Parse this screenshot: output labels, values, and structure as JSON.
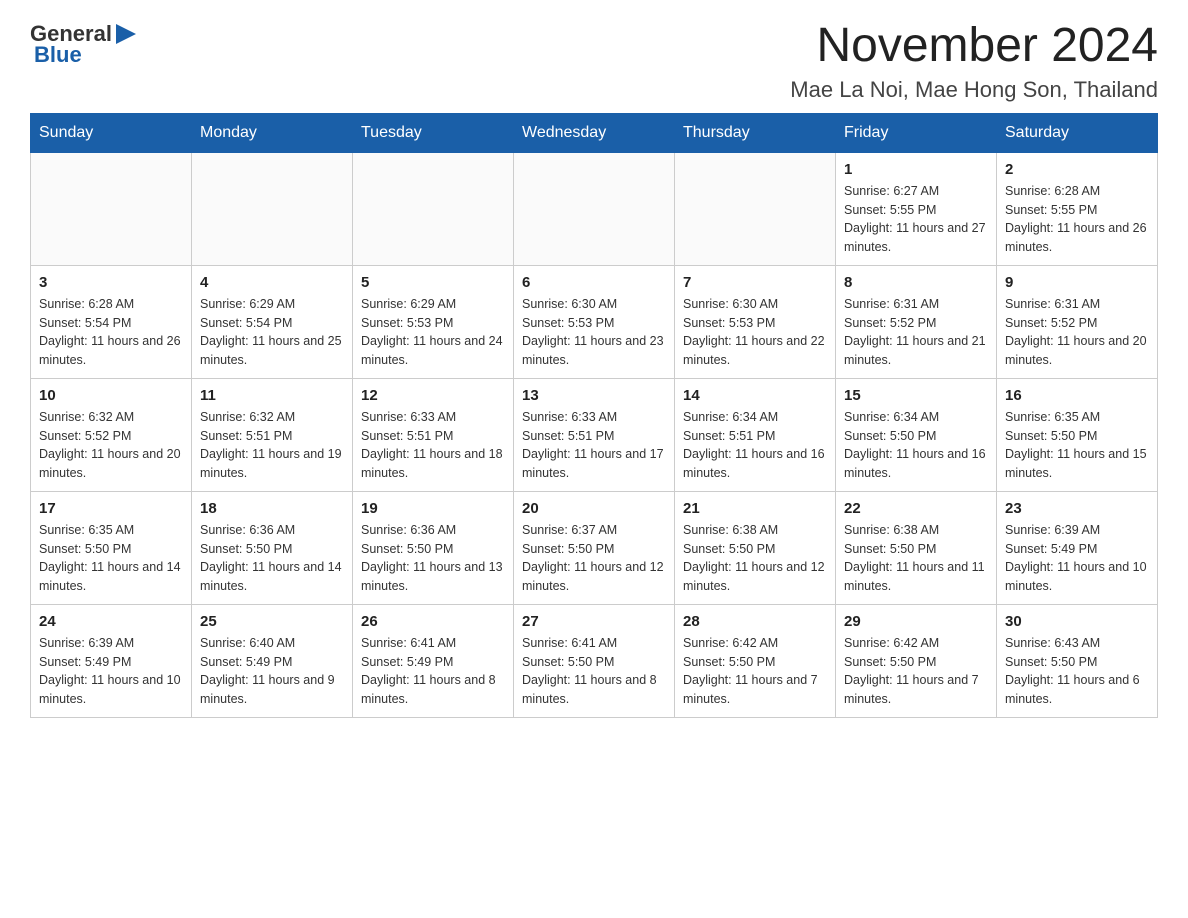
{
  "header": {
    "logo": {
      "general": "General",
      "arrow_icon": "▶",
      "blue": "Blue"
    },
    "title": "November 2024",
    "location": "Mae La Noi, Mae Hong Son, Thailand"
  },
  "weekdays": [
    "Sunday",
    "Monday",
    "Tuesday",
    "Wednesday",
    "Thursday",
    "Friday",
    "Saturday"
  ],
  "weeks": [
    [
      {
        "day": "",
        "sunrise": "",
        "sunset": "",
        "daylight": ""
      },
      {
        "day": "",
        "sunrise": "",
        "sunset": "",
        "daylight": ""
      },
      {
        "day": "",
        "sunrise": "",
        "sunset": "",
        "daylight": ""
      },
      {
        "day": "",
        "sunrise": "",
        "sunset": "",
        "daylight": ""
      },
      {
        "day": "",
        "sunrise": "",
        "sunset": "",
        "daylight": ""
      },
      {
        "day": "1",
        "sunrise": "Sunrise: 6:27 AM",
        "sunset": "Sunset: 5:55 PM",
        "daylight": "Daylight: 11 hours and 27 minutes."
      },
      {
        "day": "2",
        "sunrise": "Sunrise: 6:28 AM",
        "sunset": "Sunset: 5:55 PM",
        "daylight": "Daylight: 11 hours and 26 minutes."
      }
    ],
    [
      {
        "day": "3",
        "sunrise": "Sunrise: 6:28 AM",
        "sunset": "Sunset: 5:54 PM",
        "daylight": "Daylight: 11 hours and 26 minutes."
      },
      {
        "day": "4",
        "sunrise": "Sunrise: 6:29 AM",
        "sunset": "Sunset: 5:54 PM",
        "daylight": "Daylight: 11 hours and 25 minutes."
      },
      {
        "day": "5",
        "sunrise": "Sunrise: 6:29 AM",
        "sunset": "Sunset: 5:53 PM",
        "daylight": "Daylight: 11 hours and 24 minutes."
      },
      {
        "day": "6",
        "sunrise": "Sunrise: 6:30 AM",
        "sunset": "Sunset: 5:53 PM",
        "daylight": "Daylight: 11 hours and 23 minutes."
      },
      {
        "day": "7",
        "sunrise": "Sunrise: 6:30 AM",
        "sunset": "Sunset: 5:53 PM",
        "daylight": "Daylight: 11 hours and 22 minutes."
      },
      {
        "day": "8",
        "sunrise": "Sunrise: 6:31 AM",
        "sunset": "Sunset: 5:52 PM",
        "daylight": "Daylight: 11 hours and 21 minutes."
      },
      {
        "day": "9",
        "sunrise": "Sunrise: 6:31 AM",
        "sunset": "Sunset: 5:52 PM",
        "daylight": "Daylight: 11 hours and 20 minutes."
      }
    ],
    [
      {
        "day": "10",
        "sunrise": "Sunrise: 6:32 AM",
        "sunset": "Sunset: 5:52 PM",
        "daylight": "Daylight: 11 hours and 20 minutes."
      },
      {
        "day": "11",
        "sunrise": "Sunrise: 6:32 AM",
        "sunset": "Sunset: 5:51 PM",
        "daylight": "Daylight: 11 hours and 19 minutes."
      },
      {
        "day": "12",
        "sunrise": "Sunrise: 6:33 AM",
        "sunset": "Sunset: 5:51 PM",
        "daylight": "Daylight: 11 hours and 18 minutes."
      },
      {
        "day": "13",
        "sunrise": "Sunrise: 6:33 AM",
        "sunset": "Sunset: 5:51 PM",
        "daylight": "Daylight: 11 hours and 17 minutes."
      },
      {
        "day": "14",
        "sunrise": "Sunrise: 6:34 AM",
        "sunset": "Sunset: 5:51 PM",
        "daylight": "Daylight: 11 hours and 16 minutes."
      },
      {
        "day": "15",
        "sunrise": "Sunrise: 6:34 AM",
        "sunset": "Sunset: 5:50 PM",
        "daylight": "Daylight: 11 hours and 16 minutes."
      },
      {
        "day": "16",
        "sunrise": "Sunrise: 6:35 AM",
        "sunset": "Sunset: 5:50 PM",
        "daylight": "Daylight: 11 hours and 15 minutes."
      }
    ],
    [
      {
        "day": "17",
        "sunrise": "Sunrise: 6:35 AM",
        "sunset": "Sunset: 5:50 PM",
        "daylight": "Daylight: 11 hours and 14 minutes."
      },
      {
        "day": "18",
        "sunrise": "Sunrise: 6:36 AM",
        "sunset": "Sunset: 5:50 PM",
        "daylight": "Daylight: 11 hours and 14 minutes."
      },
      {
        "day": "19",
        "sunrise": "Sunrise: 6:36 AM",
        "sunset": "Sunset: 5:50 PM",
        "daylight": "Daylight: 11 hours and 13 minutes."
      },
      {
        "day": "20",
        "sunrise": "Sunrise: 6:37 AM",
        "sunset": "Sunset: 5:50 PM",
        "daylight": "Daylight: 11 hours and 12 minutes."
      },
      {
        "day": "21",
        "sunrise": "Sunrise: 6:38 AM",
        "sunset": "Sunset: 5:50 PM",
        "daylight": "Daylight: 11 hours and 12 minutes."
      },
      {
        "day": "22",
        "sunrise": "Sunrise: 6:38 AM",
        "sunset": "Sunset: 5:50 PM",
        "daylight": "Daylight: 11 hours and 11 minutes."
      },
      {
        "day": "23",
        "sunrise": "Sunrise: 6:39 AM",
        "sunset": "Sunset: 5:49 PM",
        "daylight": "Daylight: 11 hours and 10 minutes."
      }
    ],
    [
      {
        "day": "24",
        "sunrise": "Sunrise: 6:39 AM",
        "sunset": "Sunset: 5:49 PM",
        "daylight": "Daylight: 11 hours and 10 minutes."
      },
      {
        "day": "25",
        "sunrise": "Sunrise: 6:40 AM",
        "sunset": "Sunset: 5:49 PM",
        "daylight": "Daylight: 11 hours and 9 minutes."
      },
      {
        "day": "26",
        "sunrise": "Sunrise: 6:41 AM",
        "sunset": "Sunset: 5:49 PM",
        "daylight": "Daylight: 11 hours and 8 minutes."
      },
      {
        "day": "27",
        "sunrise": "Sunrise: 6:41 AM",
        "sunset": "Sunset: 5:50 PM",
        "daylight": "Daylight: 11 hours and 8 minutes."
      },
      {
        "day": "28",
        "sunrise": "Sunrise: 6:42 AM",
        "sunset": "Sunset: 5:50 PM",
        "daylight": "Daylight: 11 hours and 7 minutes."
      },
      {
        "day": "29",
        "sunrise": "Sunrise: 6:42 AM",
        "sunset": "Sunset: 5:50 PM",
        "daylight": "Daylight: 11 hours and 7 minutes."
      },
      {
        "day": "30",
        "sunrise": "Sunrise: 6:43 AM",
        "sunset": "Sunset: 5:50 PM",
        "daylight": "Daylight: 11 hours and 6 minutes."
      }
    ]
  ]
}
